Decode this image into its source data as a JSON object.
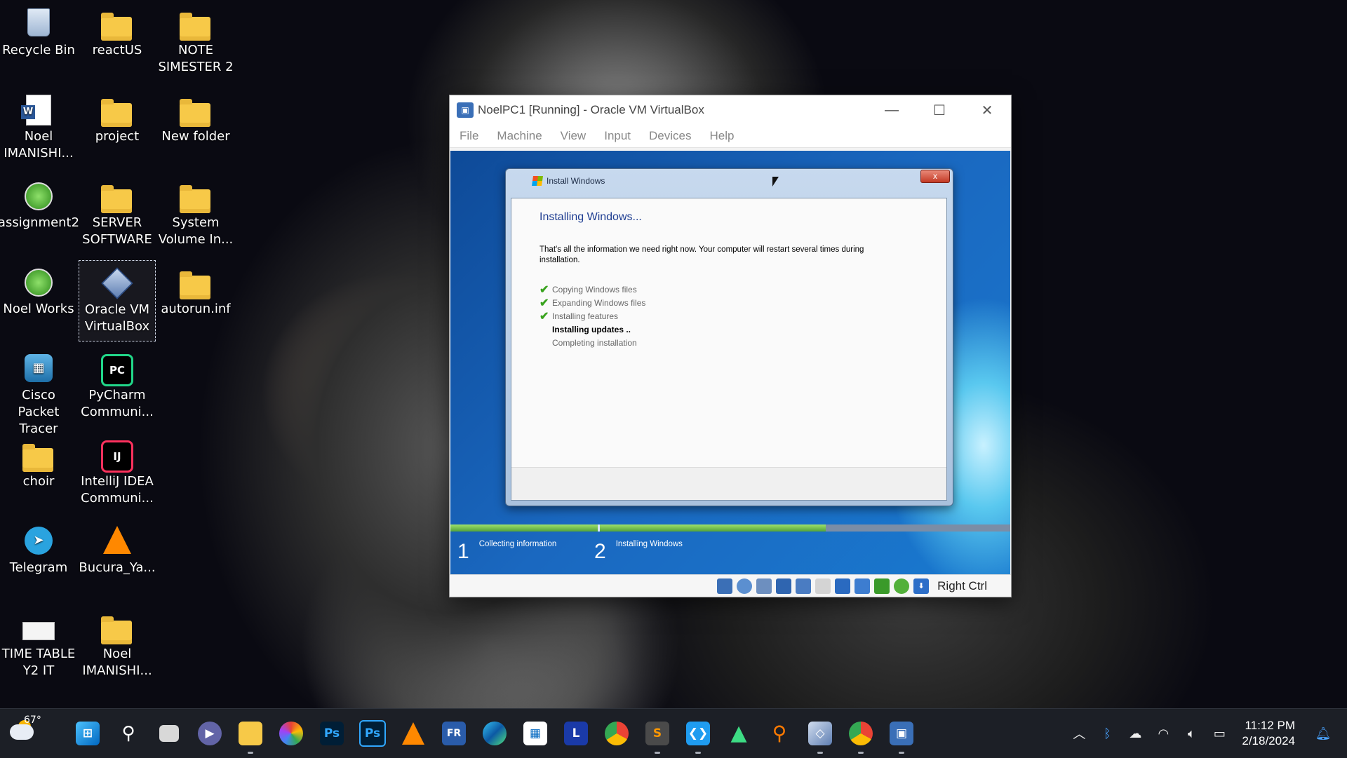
{
  "desktop": {
    "icons": [
      {
        "label": "Recycle Bin",
        "icon": "recycle-bin-icon"
      },
      {
        "label": "reactUS",
        "icon": "folder-icon"
      },
      {
        "label": "NOTE SIMESTER 2",
        "icon": "folder-icon"
      },
      {
        "label": "Noel IMANISHI...",
        "icon": "word-document-icon"
      },
      {
        "label": "project",
        "icon": "folder-icon"
      },
      {
        "label": "New folder",
        "icon": "folder-icon"
      },
      {
        "label": "assignment2",
        "icon": "packet-tracer-file-icon"
      },
      {
        "label": "SERVER SOFTWARE",
        "icon": "folder-icon"
      },
      {
        "label": "System Volume In...",
        "icon": "folder-icon"
      },
      {
        "label": "Noel Works",
        "icon": "packet-tracer-file-icon"
      },
      {
        "label": "Oracle VM VirtualBox",
        "icon": "virtualbox-icon"
      },
      {
        "label": "autorun.inf",
        "icon": "folder-icon"
      },
      {
        "label": "Cisco Packet Tracer",
        "icon": "cisco-packet-tracer-icon"
      },
      {
        "label": "PyCharm Communi...",
        "icon": "pycharm-icon"
      },
      {
        "label": "choir",
        "icon": "folder-icon"
      },
      {
        "label": "IntelliJ IDEA Communi...",
        "icon": "intellij-icon"
      },
      {
        "label": "Telegram",
        "icon": "telegram-icon"
      },
      {
        "label": "Bucura_Ya...",
        "icon": "vlc-icon"
      },
      {
        "label": "TIME TABLE Y2 IT",
        "icon": "image-file-icon"
      },
      {
        "label": "Noel IMANISHI...",
        "icon": "folder-icon"
      }
    ]
  },
  "vbox": {
    "title": "NoelPC1 [Running] - Oracle VM VirtualBox",
    "controls": {
      "minimize": "—",
      "maximize": "☐",
      "close": "✕"
    },
    "menu": [
      "File",
      "Machine",
      "View",
      "Input",
      "Devices",
      "Help"
    ],
    "host_key": "Right Ctrl"
  },
  "installer": {
    "title": "Install Windows",
    "close": "x",
    "heading": "Installing Windows...",
    "info": "That's all the information we need right now. Your computer will restart several times during installation.",
    "steps": [
      {
        "label": "Copying Windows files",
        "done": true
      },
      {
        "label": "Expanding Windows files",
        "done": true
      },
      {
        "label": "Installing features",
        "done": true
      },
      {
        "label": "Installing updates ..",
        "done": false,
        "active": true
      },
      {
        "label": "Completing installation",
        "done": false
      }
    ],
    "phases": [
      {
        "num": "1",
        "label": "Collecting information"
      },
      {
        "num": "2",
        "label": "Installing Windows"
      }
    ],
    "progress": {
      "phase1_fraction": 1.0,
      "phase2_fraction": 0.55
    }
  },
  "taskbar": {
    "temperature": "67°",
    "apps": [
      "start-icon",
      "search-icon",
      "task-view-icon",
      "teams-chat-icon",
      "file-explorer-icon",
      "picasa-icon",
      "photoshop-icon",
      "photoshop-icon-2",
      "vlc-icon",
      "filezilla-icon",
      "edge-icon",
      "microsoft-store-icon",
      "l-app-icon",
      "chrome-icon",
      "sublime-icon",
      "vscode-icon",
      "android-studio-icon",
      "search-tool-icon",
      "virtualbox-icon",
      "chrome-profile-icon",
      "virtualbox-vm-icon"
    ],
    "time": "11:12 PM",
    "date": "2/18/2024"
  }
}
